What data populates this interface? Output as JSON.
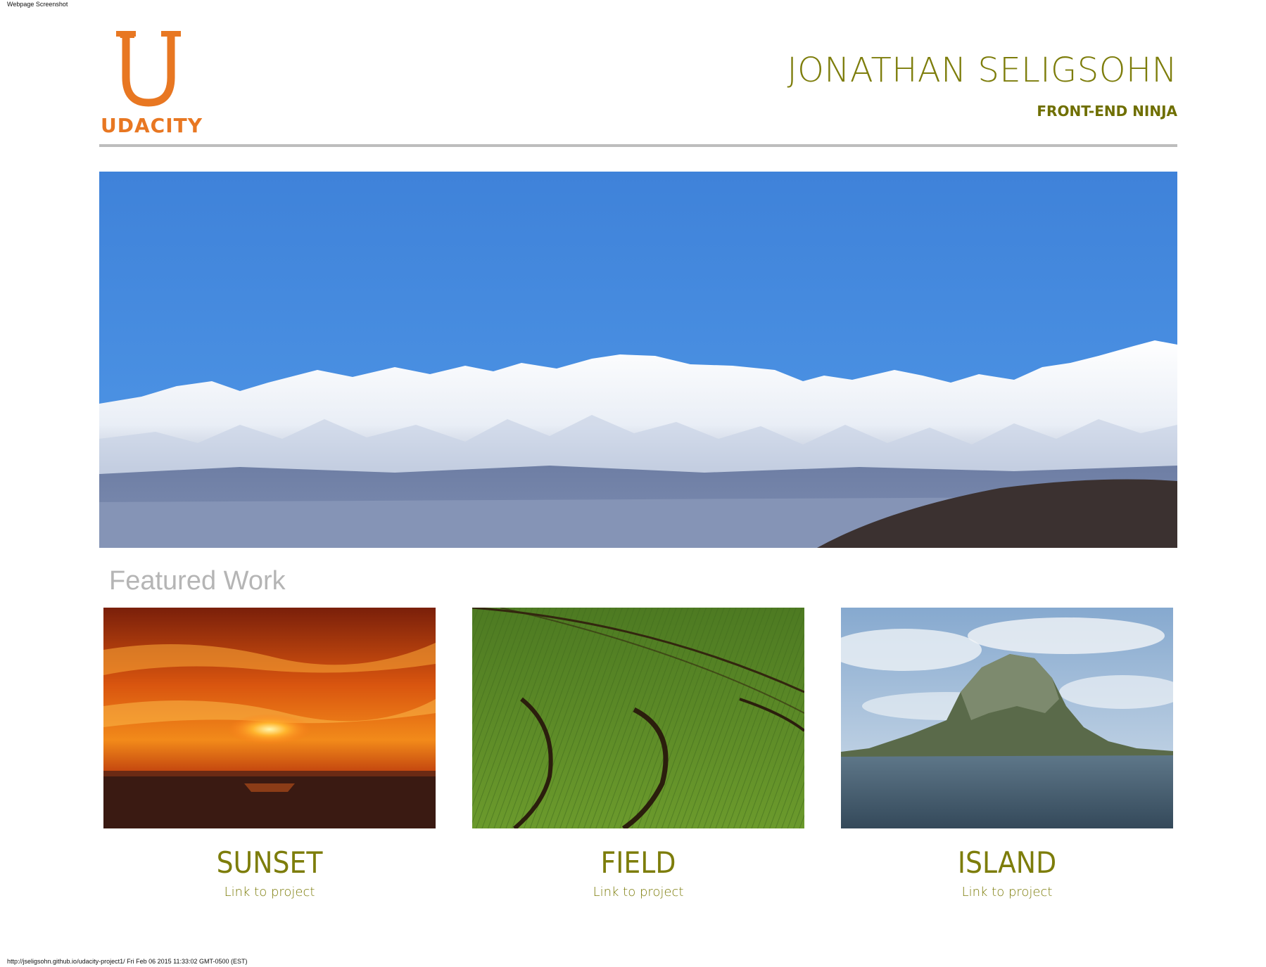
{
  "screenshot": {
    "caption": "Webpage Screenshot",
    "footer": "http://jseligsohn.github.io/udacity-project1/ Fri Feb 06 2015 11:33:02 GMT-0500 (EST)"
  },
  "header": {
    "logo_letter": "U",
    "logo_text": "UDACITY",
    "name": "JONATHAN SELIGSOHN",
    "role": "FRONT-END NINJA"
  },
  "featured": {
    "title": "Featured Work",
    "projects": [
      {
        "title": "SUNSET",
        "link": "Link to project",
        "image": "sunset-image"
      },
      {
        "title": "FIELD",
        "link": "Link to project",
        "image": "field-image"
      },
      {
        "title": "ISLAND",
        "link": "Link to project",
        "image": "island-image"
      }
    ]
  },
  "colors": {
    "brand_orange": "#e87722",
    "olive": "#7d7d0b",
    "divider_gray": "#bdbdbd",
    "featured_gray": "#b5b5b5"
  }
}
